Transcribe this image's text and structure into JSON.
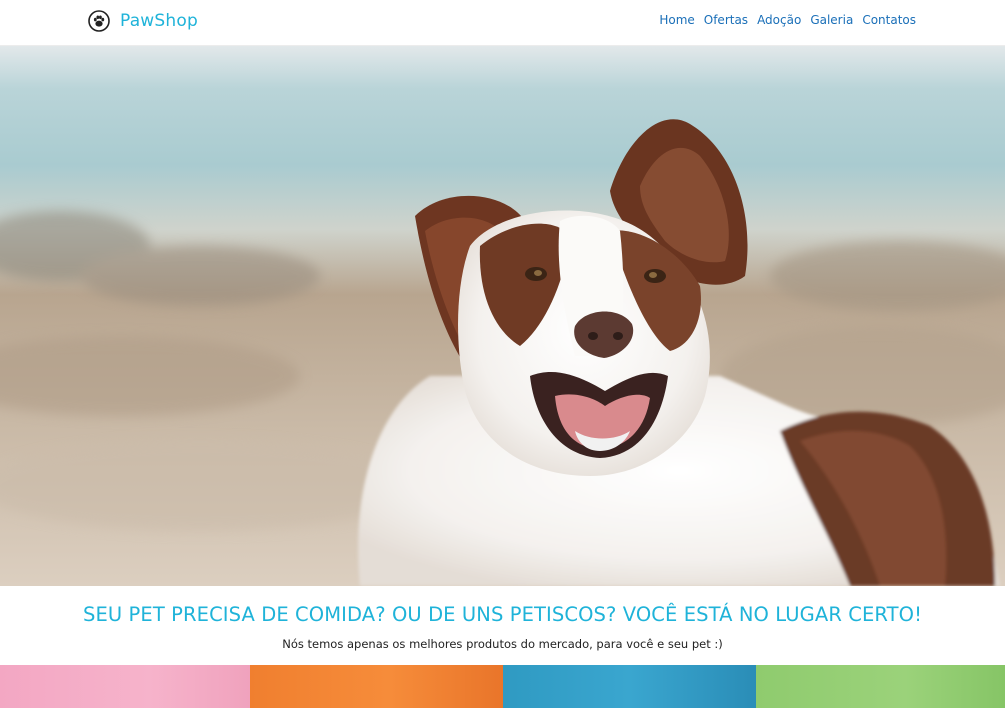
{
  "header": {
    "brand_name": "PawShop",
    "brand_icon": "paw-icon",
    "nav": [
      {
        "label": "Home"
      },
      {
        "label": "Ofertas"
      },
      {
        "label": "Adoção"
      },
      {
        "label": "Galeria"
      },
      {
        "label": "Contatos"
      }
    ]
  },
  "hero": {
    "image": "dog-photo"
  },
  "tagline": {
    "headline": "SEU PET PRECISA DE COMIDA? OU DE UNS PETISCOS? VOCÊ ESTÁ NO LUGAR CERTO!",
    "subtext": "Nós temos apenas os melhores produtos do mercado, para você e seu pet :)"
  },
  "tiles": [
    {
      "color": "#f3a7c3"
    },
    {
      "color": "#f07f2f"
    },
    {
      "color": "#2f9ac2"
    },
    {
      "color": "#8fcb6e"
    }
  ],
  "colors": {
    "brand": "#1fb3d9",
    "nav_link": "#1a6fb8"
  }
}
